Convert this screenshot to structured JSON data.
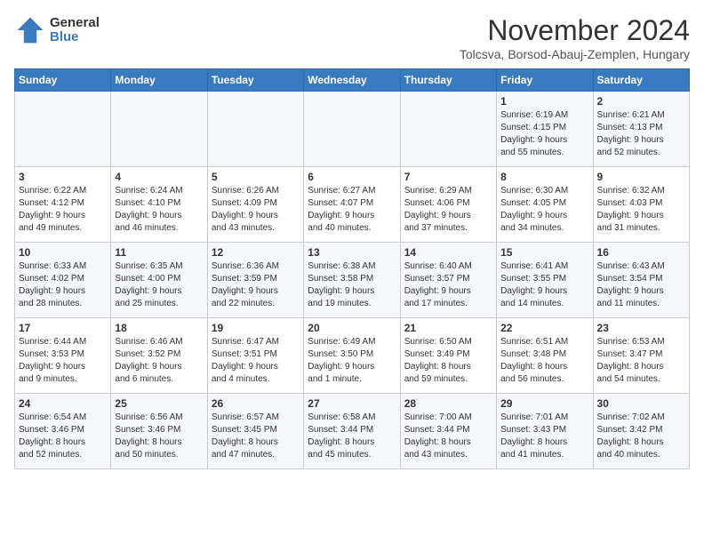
{
  "header": {
    "logo_general": "General",
    "logo_blue": "Blue",
    "title": "November 2024",
    "subtitle": "Tolcsva, Borsod-Abauj-Zemplen, Hungary"
  },
  "weekdays": [
    "Sunday",
    "Monday",
    "Tuesday",
    "Wednesday",
    "Thursday",
    "Friday",
    "Saturday"
  ],
  "weeks": [
    [
      {
        "day": "",
        "info": ""
      },
      {
        "day": "",
        "info": ""
      },
      {
        "day": "",
        "info": ""
      },
      {
        "day": "",
        "info": ""
      },
      {
        "day": "",
        "info": ""
      },
      {
        "day": "1",
        "info": "Sunrise: 6:19 AM\nSunset: 4:15 PM\nDaylight: 9 hours\nand 55 minutes."
      },
      {
        "day": "2",
        "info": "Sunrise: 6:21 AM\nSunset: 4:13 PM\nDaylight: 9 hours\nand 52 minutes."
      }
    ],
    [
      {
        "day": "3",
        "info": "Sunrise: 6:22 AM\nSunset: 4:12 PM\nDaylight: 9 hours\nand 49 minutes."
      },
      {
        "day": "4",
        "info": "Sunrise: 6:24 AM\nSunset: 4:10 PM\nDaylight: 9 hours\nand 46 minutes."
      },
      {
        "day": "5",
        "info": "Sunrise: 6:26 AM\nSunset: 4:09 PM\nDaylight: 9 hours\nand 43 minutes."
      },
      {
        "day": "6",
        "info": "Sunrise: 6:27 AM\nSunset: 4:07 PM\nDaylight: 9 hours\nand 40 minutes."
      },
      {
        "day": "7",
        "info": "Sunrise: 6:29 AM\nSunset: 4:06 PM\nDaylight: 9 hours\nand 37 minutes."
      },
      {
        "day": "8",
        "info": "Sunrise: 6:30 AM\nSunset: 4:05 PM\nDaylight: 9 hours\nand 34 minutes."
      },
      {
        "day": "9",
        "info": "Sunrise: 6:32 AM\nSunset: 4:03 PM\nDaylight: 9 hours\nand 31 minutes."
      }
    ],
    [
      {
        "day": "10",
        "info": "Sunrise: 6:33 AM\nSunset: 4:02 PM\nDaylight: 9 hours\nand 28 minutes."
      },
      {
        "day": "11",
        "info": "Sunrise: 6:35 AM\nSunset: 4:00 PM\nDaylight: 9 hours\nand 25 minutes."
      },
      {
        "day": "12",
        "info": "Sunrise: 6:36 AM\nSunset: 3:59 PM\nDaylight: 9 hours\nand 22 minutes."
      },
      {
        "day": "13",
        "info": "Sunrise: 6:38 AM\nSunset: 3:58 PM\nDaylight: 9 hours\nand 19 minutes."
      },
      {
        "day": "14",
        "info": "Sunrise: 6:40 AM\nSunset: 3:57 PM\nDaylight: 9 hours\nand 17 minutes."
      },
      {
        "day": "15",
        "info": "Sunrise: 6:41 AM\nSunset: 3:55 PM\nDaylight: 9 hours\nand 14 minutes."
      },
      {
        "day": "16",
        "info": "Sunrise: 6:43 AM\nSunset: 3:54 PM\nDaylight: 9 hours\nand 11 minutes."
      }
    ],
    [
      {
        "day": "17",
        "info": "Sunrise: 6:44 AM\nSunset: 3:53 PM\nDaylight: 9 hours\nand 9 minutes."
      },
      {
        "day": "18",
        "info": "Sunrise: 6:46 AM\nSunset: 3:52 PM\nDaylight: 9 hours\nand 6 minutes."
      },
      {
        "day": "19",
        "info": "Sunrise: 6:47 AM\nSunset: 3:51 PM\nDaylight: 9 hours\nand 4 minutes."
      },
      {
        "day": "20",
        "info": "Sunrise: 6:49 AM\nSunset: 3:50 PM\nDaylight: 9 hours\nand 1 minute."
      },
      {
        "day": "21",
        "info": "Sunrise: 6:50 AM\nSunset: 3:49 PM\nDaylight: 8 hours\nand 59 minutes."
      },
      {
        "day": "22",
        "info": "Sunrise: 6:51 AM\nSunset: 3:48 PM\nDaylight: 8 hours\nand 56 minutes."
      },
      {
        "day": "23",
        "info": "Sunrise: 6:53 AM\nSunset: 3:47 PM\nDaylight: 8 hours\nand 54 minutes."
      }
    ],
    [
      {
        "day": "24",
        "info": "Sunrise: 6:54 AM\nSunset: 3:46 PM\nDaylight: 8 hours\nand 52 minutes."
      },
      {
        "day": "25",
        "info": "Sunrise: 6:56 AM\nSunset: 3:46 PM\nDaylight: 8 hours\nand 50 minutes."
      },
      {
        "day": "26",
        "info": "Sunrise: 6:57 AM\nSunset: 3:45 PM\nDaylight: 8 hours\nand 47 minutes."
      },
      {
        "day": "27",
        "info": "Sunrise: 6:58 AM\nSunset: 3:44 PM\nDaylight: 8 hours\nand 45 minutes."
      },
      {
        "day": "28",
        "info": "Sunrise: 7:00 AM\nSunset: 3:44 PM\nDaylight: 8 hours\nand 43 minutes."
      },
      {
        "day": "29",
        "info": "Sunrise: 7:01 AM\nSunset: 3:43 PM\nDaylight: 8 hours\nand 41 minutes."
      },
      {
        "day": "30",
        "info": "Sunrise: 7:02 AM\nSunset: 3:42 PM\nDaylight: 8 hours\nand 40 minutes."
      }
    ]
  ]
}
